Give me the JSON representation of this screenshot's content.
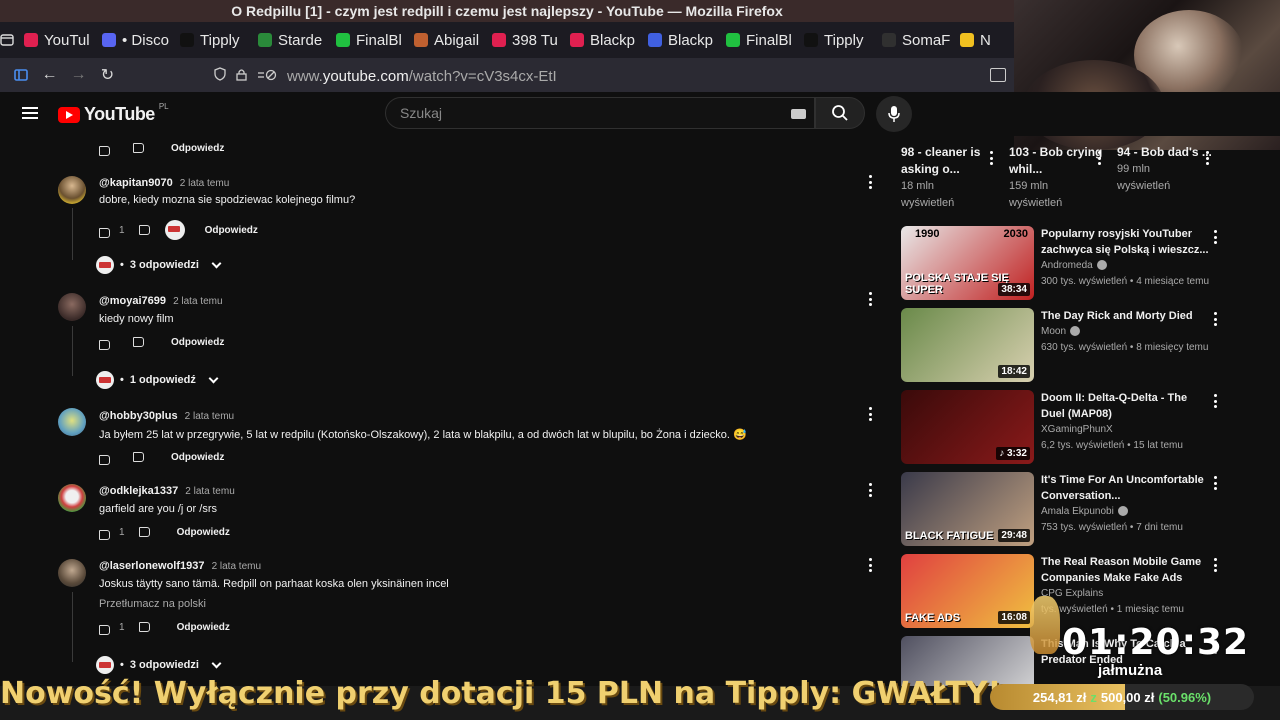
{
  "window": {
    "title": "O Redpillu [1] - czym jest redpill i czemu jest najlepszy - YouTube — Mozilla Firefox"
  },
  "tabs": [
    {
      "label": "YouTul",
      "color": "#e02050"
    },
    {
      "label": "• Disco",
      "color": "#5865f2"
    },
    {
      "label": "Tipply",
      "color": "#111111"
    },
    {
      "label": "Starde",
      "color": "#2a8a3a"
    },
    {
      "label": "FinalBl",
      "color": "#20c040"
    },
    {
      "label": "Abigail",
      "color": "#c06030"
    },
    {
      "label": "398 Tu",
      "color": "#e02050"
    },
    {
      "label": "Blackp",
      "color": "#e02050"
    },
    {
      "label": "Blackp",
      "color": "#4060e0"
    },
    {
      "label": "FinalBl",
      "color": "#20c040"
    },
    {
      "label": "Tipply",
      "color": "#111111"
    },
    {
      "label": "SomaF",
      "color": "#303030"
    },
    {
      "label": "N",
      "color": "#f0c020"
    }
  ],
  "url": {
    "prefix": "www.",
    "host": "youtube.com",
    "path": "/watch?v=cV3s4cx-EtI"
  },
  "header": {
    "logo": "YouTube",
    "region": "PL",
    "search_placeholder": "Szukaj"
  },
  "comments": {
    "reply_label": "Odpowiedz",
    "top_actions": {
      "reply": "Odpowiedz"
    },
    "items": [
      {
        "user": "@kapitan9070",
        "time": "2 lata temu",
        "text": "dobre, kiedy mozna sie spodziewac kolejnego filmu?",
        "likes": "1",
        "replies": "3 odpowiedzi"
      },
      {
        "user": "@moyai7699",
        "time": "2 lata temu",
        "text": "kiedy nowy film",
        "likes": "",
        "replies": "1 odpowiedź"
      },
      {
        "user": "@hobby30plus",
        "time": "2 lata temu",
        "text": "Ja byłem 25 lat w przegrywie, 5 lat w redpilu (Kotońsko-Olszakowy), 2 lata w blakpilu, a od dwóch lat w blupilu, bo Żona i dziecko. 😅",
        "likes": "",
        "replies": ""
      },
      {
        "user": "@odklejka1337",
        "time": "2 lata temu",
        "text": "garfield are you /j or /srs",
        "likes": "1",
        "replies": ""
      },
      {
        "user": "@laserlonewolf1937",
        "time": "2 lata temu",
        "text": "Joskus täytty sano tämä. Redpill on parhaat koska olen yksinäinen incel",
        "translate": "Przetłumacz na polski",
        "likes": "1",
        "replies": "3 odpowiedzi"
      }
    ]
  },
  "sidebar": {
    "top": [
      {
        "title": "98 - cleaner is asking o...",
        "views": "18 mln",
        "unit": "wyświetleń"
      },
      {
        "title": "103 - Bob crying whil...",
        "views": "159 mln",
        "unit": "wyświetleń"
      },
      {
        "title": "94 - Bob dad's ...",
        "views": "99 mln",
        "unit": "wyświetleń"
      }
    ],
    "videos": [
      {
        "title": "Popularny rosyjski YouTuber zachwyca się Polską i wieszcz...",
        "channel": "Andromeda",
        "verified": true,
        "meta": "300 tys. wyświetleń • 4 miesiące temu",
        "duration": "38:34",
        "thumb_a": "#e8e8e8",
        "thumb_b": "#c02020",
        "thumb_text": "POLSKA STAJE SIĘ SUPER",
        "thumb_label_a": "1990",
        "thumb_label_b": "2030"
      },
      {
        "title": "The Day Rick and Morty Died",
        "channel": "Moon",
        "verified": true,
        "meta": "630 tys. wyświetleń • 8 miesięcy temu",
        "duration": "18:42",
        "thumb_a": "#6a8a4a",
        "thumb_b": "#d8d0b0",
        "thumb_text": "",
        "thumb_label_a": "",
        "thumb_label_b": ""
      },
      {
        "title": "Doom II: Delta-Q-Delta - The Duel (MAP08)",
        "channel": "XGamingPhunX",
        "verified": false,
        "meta": "6,2 tys. wyświetleń • 15 lat temu",
        "duration": "♪ 3:32",
        "thumb_a": "#3a0a0a",
        "thumb_b": "#8a1a1a",
        "thumb_text": "",
        "thumb_label_a": "",
        "thumb_label_b": ""
      },
      {
        "title": "It's Time For An Uncomfortable Conversation...",
        "channel": "Amala Ekpunobi",
        "verified": true,
        "meta": "753 tys. wyświetleń • 7 dni temu",
        "duration": "29:48",
        "thumb_a": "#3a3a4a",
        "thumb_b": "#c0a080",
        "thumb_text": "BLACK FATIGUE",
        "thumb_label_a": "",
        "thumb_label_b": ""
      },
      {
        "title": "The Real Reason Mobile Game Companies Make Fake Ads",
        "channel": "CPG Explains",
        "verified": false,
        "meta": "tys. wyświetleń • 1 miesiąc temu",
        "duration": "16:08",
        "thumb_a": "#e04040",
        "thumb_b": "#f0c040",
        "thumb_text": "FAKE ADS",
        "thumb_label_a": "",
        "thumb_label_b": ""
      },
      {
        "title": "This Man Is Why To Catch a Predator Ended",
        "channel": "",
        "verified": false,
        "meta": "",
        "duration": "",
        "thumb_a": "#505060",
        "thumb_b": "#e0e0e0",
        "thumb_text": "",
        "thumb_label_a": "",
        "thumb_label_b": ""
      }
    ]
  },
  "overlay": {
    "timer": "01:20:32",
    "timer_label": "jałmużna",
    "marquee": "Nowość! Wyłącznie przy dotacji 15 PLN na Tipply: GWAŁTY!",
    "goal": {
      "current": "254,81 zł",
      "z": "z",
      "target": "500,00 zł",
      "percent": "(50.96%)",
      "fraction": 0.5096
    }
  }
}
